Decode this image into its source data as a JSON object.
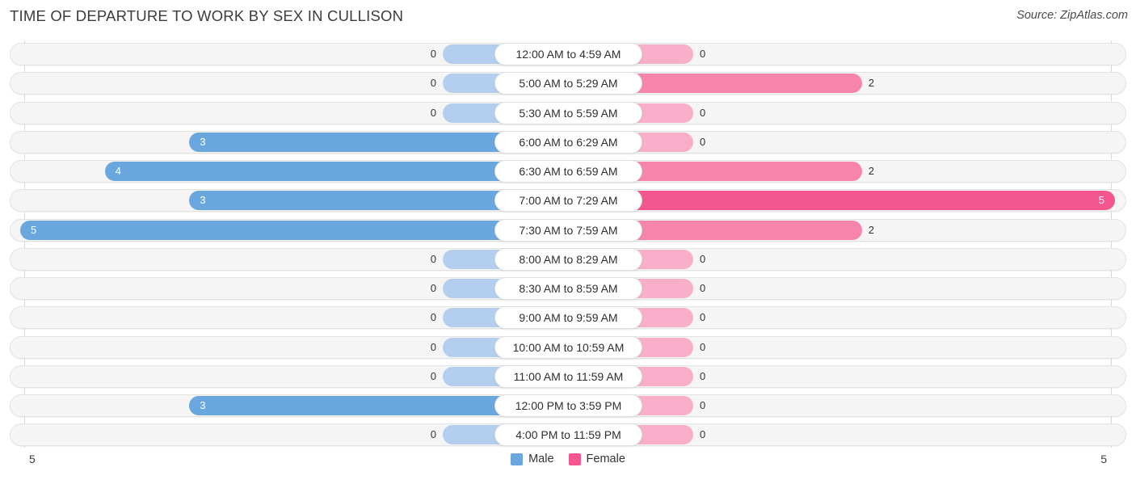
{
  "header": {
    "title": "TIME OF DEPARTURE TO WORK BY SEX IN CULLISON",
    "source": "Source: ZipAtlas.com"
  },
  "axis": {
    "left_end_label": "5",
    "right_end_label": "5"
  },
  "legend": {
    "items": [
      {
        "label": "Male",
        "color": "#6aa7de"
      },
      {
        "label": "Female",
        "color": "#f4578f"
      }
    ]
  },
  "chart_data": {
    "type": "bar",
    "subtype": "diverging-bidirectional",
    "title": "TIME OF DEPARTURE TO WORK BY SEX IN CULLISON",
    "xlabel": "",
    "ylabel": "",
    "xlim": [
      5,
      5
    ],
    "grid": true,
    "legend_position": "bottom-center",
    "categories": [
      "12:00 AM to 4:59 AM",
      "5:00 AM to 5:29 AM",
      "5:30 AM to 5:59 AM",
      "6:00 AM to 6:29 AM",
      "6:30 AM to 6:59 AM",
      "7:00 AM to 7:29 AM",
      "7:30 AM to 7:59 AM",
      "8:00 AM to 8:29 AM",
      "8:30 AM to 8:59 AM",
      "9:00 AM to 9:59 AM",
      "10:00 AM to 10:59 AM",
      "11:00 AM to 11:59 AM",
      "12:00 PM to 3:59 PM",
      "4:00 PM to 11:59 PM"
    ],
    "series": [
      {
        "name": "Male",
        "color": "#6aa7de",
        "direction": "left",
        "values": [
          0,
          0,
          0,
          3,
          4,
          3,
          5,
          0,
          0,
          0,
          0,
          0,
          3,
          0
        ]
      },
      {
        "name": "Female",
        "color": "#f4578f",
        "direction": "right",
        "values": [
          0,
          2,
          0,
          0,
          2,
          5,
          2,
          0,
          0,
          0,
          0,
          0,
          0,
          0
        ]
      }
    ]
  },
  "rows": [
    {
      "category": "12:00 AM to 4:59 AM",
      "male": "0",
      "female": "0"
    },
    {
      "category": "5:00 AM to 5:29 AM",
      "male": "0",
      "female": "2"
    },
    {
      "category": "5:30 AM to 5:59 AM",
      "male": "0",
      "female": "0"
    },
    {
      "category": "6:00 AM to 6:29 AM",
      "male": "3",
      "female": "0"
    },
    {
      "category": "6:30 AM to 6:59 AM",
      "male": "4",
      "female": "2"
    },
    {
      "category": "7:00 AM to 7:29 AM",
      "male": "3",
      "female": "5"
    },
    {
      "category": "7:30 AM to 7:59 AM",
      "male": "5",
      "female": "2"
    },
    {
      "category": "8:00 AM to 8:29 AM",
      "male": "0",
      "female": "0"
    },
    {
      "category": "8:30 AM to 8:59 AM",
      "male": "0",
      "female": "0"
    },
    {
      "category": "9:00 AM to 9:59 AM",
      "male": "0",
      "female": "0"
    },
    {
      "category": "10:00 AM to 10:59 AM",
      "male": "0",
      "female": "0"
    },
    {
      "category": "11:00 AM to 11:59 AM",
      "male": "0",
      "female": "0"
    },
    {
      "category": "12:00 PM to 3:59 PM",
      "male": "3",
      "female": "0"
    },
    {
      "category": "4:00 PM to 11:59 PM",
      "male": "0",
      "female": "0"
    }
  ]
}
